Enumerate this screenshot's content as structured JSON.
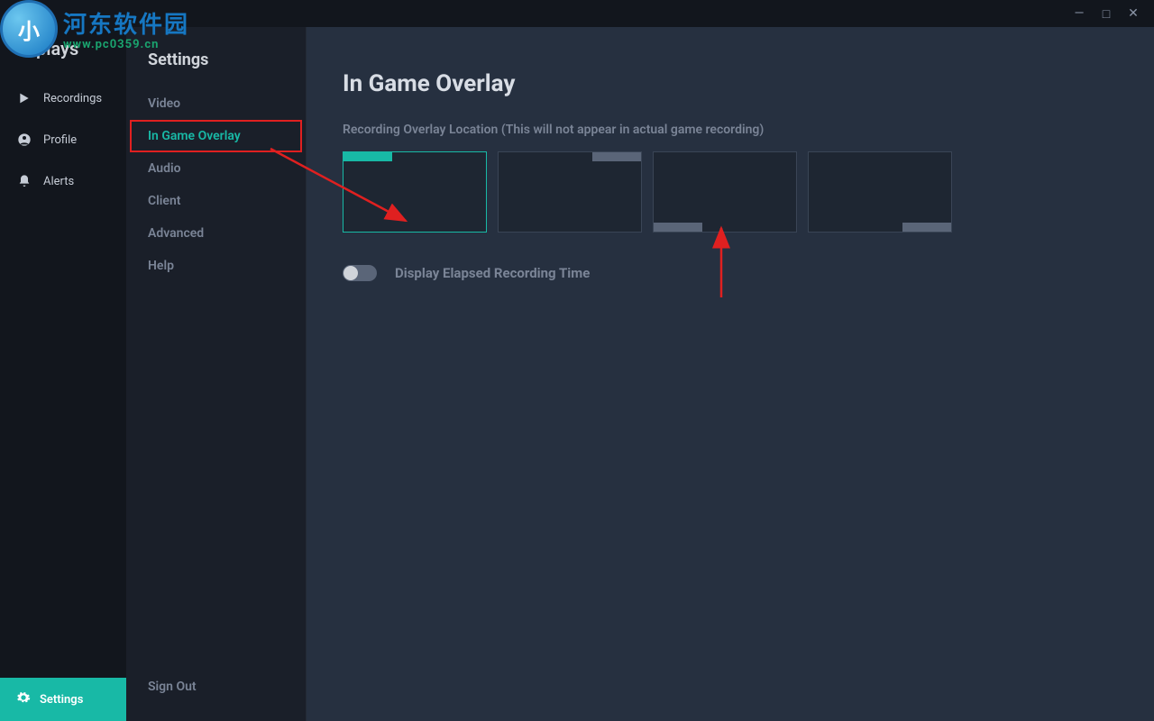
{
  "window": {
    "minimize": "—",
    "maximize": "□",
    "close": "✕"
  },
  "logo": "plays",
  "primary_nav": {
    "recordings": "Recordings",
    "profile": "Profile",
    "alerts": "Alerts",
    "settings": "Settings"
  },
  "secondary_nav": {
    "title": "Settings",
    "items": {
      "video": "Video",
      "overlay": "In Game Overlay",
      "audio": "Audio",
      "client": "Client",
      "advanced": "Advanced",
      "help": "Help"
    },
    "sign_out": "Sign Out"
  },
  "content": {
    "title": "In Game Overlay",
    "location_label": "Recording Overlay Location (This will not appear in actual game recording)",
    "toggle_label": "Display Elapsed Recording Time"
  },
  "watermark": {
    "glyph": "小",
    "cn": "河东软件园",
    "url": "www.pc0359.cn"
  }
}
